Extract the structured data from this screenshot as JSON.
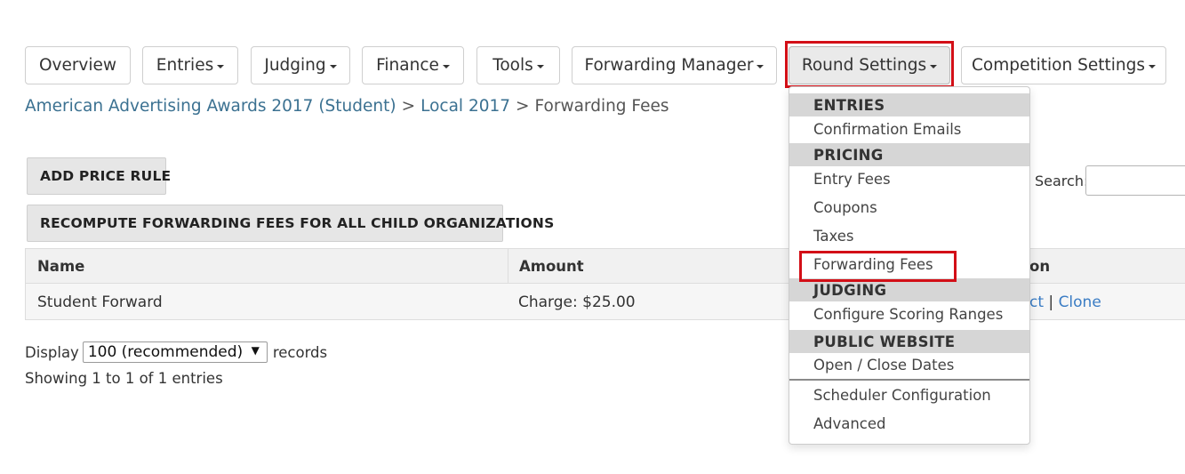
{
  "nav": {
    "overview": "Overview",
    "entries": "Entries",
    "judging": "Judging",
    "finance": "Finance",
    "tools": "Tools",
    "forwarding_manager": "Forwarding Manager",
    "round_settings": "Round Settings",
    "competition_settings": "Competition Settings"
  },
  "breadcrumb": {
    "program": "American Advertising Awards 2017 (Student)",
    "round": "Local 2017",
    "current": "Forwarding Fees",
    "separator": ">"
  },
  "buttons": {
    "add_price_rule": "ADD PRICE RULE",
    "recompute": "RECOMPUTE FORWARDING FEES FOR ALL CHILD ORGANIZATIONS"
  },
  "search": {
    "label": "Search:",
    "value": ""
  },
  "table": {
    "headers": {
      "name": "Name",
      "amount": "Amount",
      "action_partial": "on"
    },
    "rows": [
      {
        "name": "Student Forward",
        "amount": "Charge: $25.00",
        "action_partial": "ct",
        "divider": "|",
        "clone": "Clone"
      }
    ]
  },
  "display": {
    "label_before": "Display",
    "selected": "100 (recommended)",
    "arrow": "▼",
    "label_after": "records",
    "showing": "Showing 1 to 1 of 1 entries"
  },
  "dropdown": {
    "entries_header": "ENTRIES",
    "confirmation_emails": "Confirmation Emails",
    "pricing_header": "PRICING",
    "entry_fees": "Entry Fees",
    "coupons": "Coupons",
    "taxes": "Taxes",
    "forwarding_fees": "Forwarding Fees",
    "judging_header": "JUDGING",
    "configure_scoring_ranges": "Configure Scoring Ranges",
    "public_website_header": "PUBLIC WEBSITE",
    "open_close_dates": "Open / Close Dates",
    "scheduler_configuration": "Scheduler Configuration",
    "advanced": "Advanced"
  },
  "colors": {
    "highlight": "#d30f17",
    "link": "#3a7cc4",
    "breadcrumb_link": "#3b7191"
  }
}
